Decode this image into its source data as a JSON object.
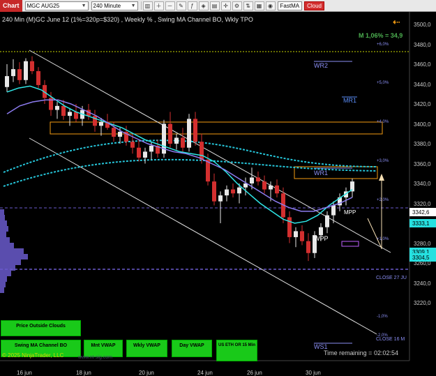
{
  "toolbar": {
    "chart_label": "Chart",
    "instrument": "MGC AUG25",
    "interval": "240 Minute",
    "fastma_label": "FastMA",
    "cloud_label": "Cloud"
  },
  "chart": {
    "title": "240 Min  (M)GC June 12  (1%=320p=$320) , Weekly % , Swing MA Channel BO, Wkly TPO",
    "m_readout": "M 1,06% = 34,9",
    "time_remaining": "Time remaining = 02:02:54",
    "copyright": "© 2025 NinjaTrader, LLC",
    "colors": {
      "up_candle": "#e8e8e8",
      "down_candle": "#d32f2f",
      "cyan_ma": "#2ee6e6",
      "purple_ma": "#8d7cf0",
      "teal_dash": "#26c6da",
      "channel": "#e0e0e0",
      "orange_box": "#f39c12",
      "tag_cyan": "#26e0e0",
      "tag_white": "#ffffff",
      "green_button": "#19c919"
    }
  },
  "price_axis": {
    "labels": [
      "3500,0",
      "3480,0",
      "3460,0",
      "3440,0",
      "3420,0",
      "3400,0",
      "3380,0",
      "3360,0",
      "3340,0",
      "3320,0",
      "3300,0",
      "3280,0",
      "3260,0",
      "3240,0",
      "3220,0"
    ],
    "tags": [
      {
        "value": "3342,6",
        "color": "#ffffff"
      },
      {
        "value": "3333,1",
        "color": "#26e0e0"
      },
      {
        "value": "3309,1",
        "color": "#26e0e0"
      },
      {
        "value": "3304,5",
        "color": "#26e0e0"
      }
    ]
  },
  "date_axis": {
    "labels": [
      "16 jun",
      "18 jun",
      "20 jun",
      "24 jun",
      "26 jun",
      "30 jun"
    ]
  },
  "percent_levels": [
    "+6,0%",
    "+5,0%",
    "+4,0%",
    "+3,0%",
    "+2,0%",
    "+1,0%",
    "-1,0%",
    "-2,0%"
  ],
  "level_labels": {
    "wr2": "WR2",
    "mr1": "MR1",
    "wr1": "WR1",
    "mpp": "MPP",
    "wpp": "WPP",
    "ws1": "WS1",
    "close_27": "CLOSE 27 JU",
    "close_16": "CLOSE 16 M"
  },
  "buttons": {
    "price_outside_clouds": "Price Outside Clouds",
    "swing_ma": "Swing MA Channel BO",
    "mnt_vwap": "Mnt VWAP",
    "wkly_vwap": "Wkly VWAP",
    "day_vwap": "Day VWAP",
    "us_eth_or": "US ETH OR 15 Min"
  },
  "watermark": "www.nt-sig.com",
  "chart_data": {
    "type": "candlestick",
    "title": "240 Min  (M)GC June 12  (1%=320p=$320) , Weekly % , Swing MA Channel BO, Wkly TPO",
    "ylim": [
      3215,
      3505
    ],
    "x_ticks": [
      "16 jun",
      "18 jun",
      "20 jun",
      "24 jun",
      "26 jun",
      "30 jun"
    ],
    "candles": [
      [
        3437,
        3460,
        3432,
        3448
      ],
      [
        3448,
        3465,
        3442,
        3455
      ],
      [
        3455,
        3462,
        3440,
        3444
      ],
      [
        3444,
        3466,
        3440,
        3463
      ],
      [
        3463,
        3468,
        3450,
        3453
      ],
      [
        3453,
        3457,
        3436,
        3439
      ],
      [
        3439,
        3444,
        3420,
        3426
      ],
      [
        3426,
        3432,
        3408,
        3414
      ],
      [
        3414,
        3422,
        3405,
        3418
      ],
      [
        3418,
        3424,
        3404,
        3408
      ],
      [
        3408,
        3416,
        3398,
        3412
      ],
      [
        3412,
        3420,
        3402,
        3405
      ],
      [
        3405,
        3418,
        3398,
        3414
      ],
      [
        3414,
        3420,
        3404,
        3408
      ],
      [
        3408,
        3414,
        3392,
        3398
      ],
      [
        3398,
        3406,
        3388,
        3402
      ],
      [
        3402,
        3410,
        3394,
        3396
      ],
      [
        3396,
        3402,
        3382,
        3387
      ],
      [
        3387,
        3396,
        3380,
        3392
      ],
      [
        3392,
        3398,
        3378,
        3382
      ],
      [
        3382,
        3390,
        3370,
        3376
      ],
      [
        3376,
        3384,
        3362,
        3366
      ],
      [
        3366,
        3376,
        3360,
        3372
      ],
      [
        3372,
        3382,
        3364,
        3378
      ],
      [
        3378,
        3384,
        3366,
        3370
      ],
      [
        3370,
        3404,
        3366,
        3400
      ],
      [
        3400,
        3412,
        3376,
        3380
      ],
      [
        3380,
        3390,
        3374,
        3386
      ],
      [
        3386,
        3396,
        3372,
        3376
      ],
      [
        3376,
        3410,
        3372,
        3405
      ],
      [
        3405,
        3412,
        3378,
        3382
      ],
      [
        3382,
        3390,
        3360,
        3364
      ],
      [
        3364,
        3370,
        3338,
        3342
      ],
      [
        3342,
        3350,
        3318,
        3322
      ],
      [
        3322,
        3332,
        3300,
        3328
      ],
      [
        3328,
        3338,
        3322,
        3334
      ],
      [
        3334,
        3340,
        3326,
        3330
      ],
      [
        3330,
        3340,
        3320,
        3336
      ],
      [
        3336,
        3346,
        3328,
        3340
      ],
      [
        3340,
        3356,
        3334,
        3346
      ],
      [
        3346,
        3352,
        3338,
        3342
      ],
      [
        3342,
        3348,
        3330,
        3334
      ],
      [
        3334,
        3342,
        3322,
        3338
      ],
      [
        3338,
        3344,
        3326,
        3330
      ],
      [
        3330,
        3336,
        3300,
        3306
      ],
      [
        3306,
        3312,
        3280,
        3286
      ],
      [
        3286,
        3296,
        3276,
        3292
      ],
      [
        3292,
        3298,
        3278,
        3282
      ],
      [
        3282,
        3290,
        3262,
        3270
      ],
      [
        3270,
        3292,
        3265,
        3288
      ],
      [
        3288,
        3300,
        3282,
        3296
      ],
      [
        3296,
        3312,
        3290,
        3308
      ],
      [
        3308,
        3322,
        3300,
        3318
      ],
      [
        3318,
        3330,
        3312,
        3326
      ],
      [
        3326,
        3336,
        3318,
        3332
      ],
      [
        3332,
        3345,
        3326,
        3342
      ]
    ],
    "series": [
      {
        "name": "",
        "values": [
          3432,
          3436,
          3438,
          3434,
          3426,
          3418,
          3412,
          3408,
          3404,
          3400,
          3396,
          3390,
          3384,
          3380,
          3376,
          3372,
          3370,
          3368,
          3362,
          3352,
          3340,
          3330,
          3320,
          3312,
          3304,
          3300,
          3302,
          3308,
          3318,
          3326,
          3334
        ]
      },
      {
        "name": "",
        "values": [
          3410,
          3418,
          3422,
          3424,
          3424,
          3420,
          3414,
          3408,
          3400,
          3392,
          3386,
          3380,
          3376,
          3372,
          3370,
          3366,
          3360,
          3354,
          3346,
          3338,
          3330,
          3322,
          3316,
          3312,
          3312,
          3316,
          3320,
          3326
        ]
      }
    ]
  }
}
